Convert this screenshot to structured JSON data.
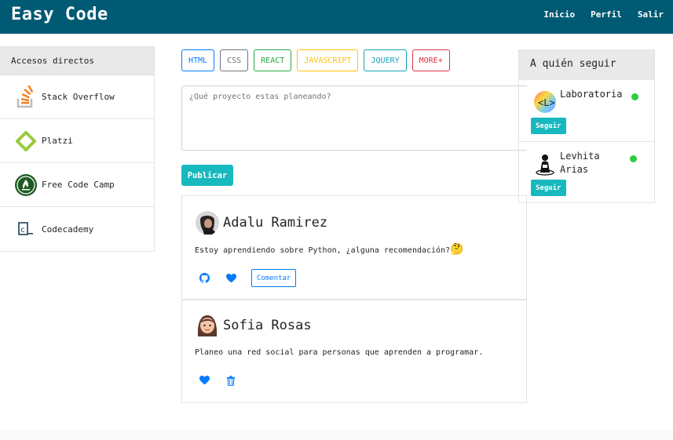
{
  "navbar": {
    "brand": "Easy Code",
    "links": [
      "Inicio",
      "Perfil",
      "Salir"
    ],
    "bg_color": "#005a73"
  },
  "shortcuts": {
    "title": "Accesos directos",
    "items": [
      {
        "label": "Stack Overflow",
        "icon": "stackoverflow-icon"
      },
      {
        "label": "Platzi",
        "icon": "platzi-icon"
      },
      {
        "label": "Free Code Camp",
        "icon": "freecodecamp-icon"
      },
      {
        "label": "Codecademy",
        "icon": "codecademy-icon"
      }
    ]
  },
  "tags": [
    {
      "label": "HTML",
      "color": "#007bff"
    },
    {
      "label": "CSS",
      "color": "#6c757d"
    },
    {
      "label": "REACT",
      "color": "#28a745"
    },
    {
      "label": "JAVASCRIPT",
      "color": "#ffc107"
    },
    {
      "label": "JQUERY",
      "color": "#17a2b8"
    },
    {
      "label": "MORE+",
      "color": "#dc3545"
    }
  ],
  "composer": {
    "placeholder": "¿Qué proyecto estas planeando?"
  },
  "publish_label": "Publicar",
  "posts": [
    {
      "author": "Adalu Ramirez",
      "text": "Estoy aprendiendo sobre Python, ¿alguna recomendación?",
      "emoji": "🤔",
      "comment_label": "Comentar"
    },
    {
      "author": "Sofia Rosas",
      "text": "Planeo una red social para personas que aprenden a programar."
    }
  ],
  "follow": {
    "title": "A quién seguir",
    "users": [
      {
        "name": "Laboratoria",
        "button": "Seguir",
        "status": "online"
      },
      {
        "name": "Levhita Arias",
        "button": "Seguir",
        "status": "online"
      }
    ]
  },
  "colors": {
    "accent": "#17b8be",
    "link": "#007bff",
    "online": "#2ecc40"
  }
}
